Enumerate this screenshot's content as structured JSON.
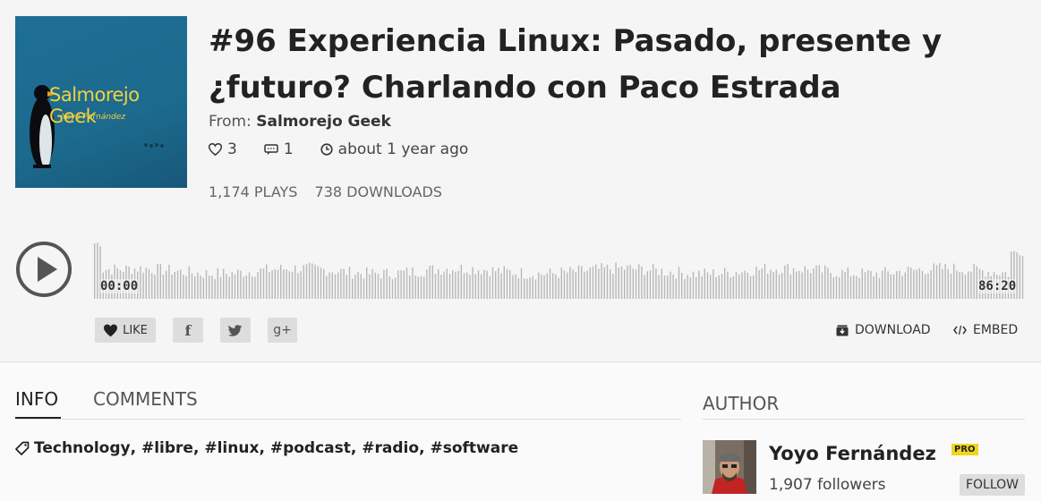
{
  "cover": {
    "title": "Salmorejo Geek",
    "subtitle": "Yoyo Fernández"
  },
  "episode": {
    "title": "#96 Experiencia Linux: Pasado, presente y ¿futuro? Charlando con Paco Estrada",
    "from_label": "From:",
    "show": "Salmorejo Geek",
    "likes": "3",
    "comments": "1",
    "age": "about 1 year ago",
    "plays": "1,174 PLAYS",
    "downloads": "738 DOWNLOADS"
  },
  "player": {
    "start_time": "00:00",
    "end_time": "86:20",
    "progress": 0
  },
  "share": {
    "like": "LIKE",
    "facebook": "f",
    "google": "g+"
  },
  "actions": {
    "download": "DOWNLOAD",
    "embed": "EMBED"
  },
  "tabs": [
    {
      "label": "INFO"
    },
    {
      "label": "COMMENTS"
    }
  ],
  "tags": {
    "category": "Technology",
    "items": [
      "#libre",
      "#linux",
      "#podcast",
      "#radio",
      "#software"
    ]
  },
  "author": {
    "heading": "AUTHOR",
    "name": "Yoyo Fernández",
    "badge": "PRO",
    "followers": "1,907 followers",
    "follow": "FOLLOW"
  },
  "colors": {
    "accent_badge": "#f1d51b",
    "cover_bg": "#1f6e94",
    "cover_text": "#f3d23c"
  },
  "icons": [
    "heart-icon",
    "comment-icon",
    "clock-icon",
    "play-icon",
    "facebook-icon",
    "twitter-icon",
    "google-plus-icon",
    "download-icon",
    "code-icon",
    "tag-icon"
  ]
}
